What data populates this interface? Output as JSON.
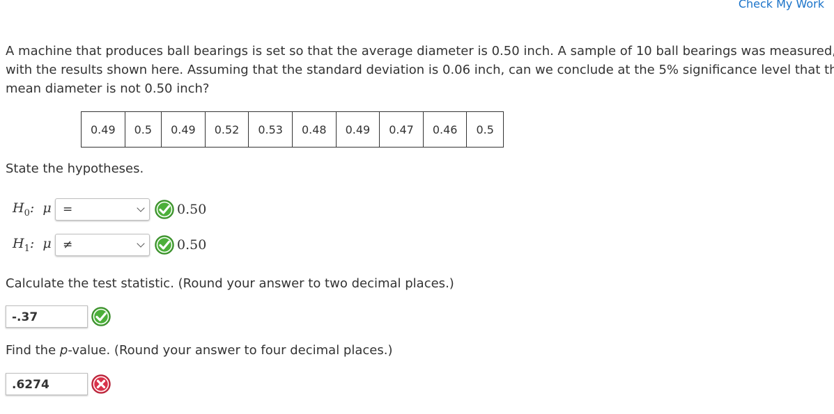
{
  "header": {
    "check_label": "Check My Work"
  },
  "question": {
    "line1": "A machine that produces ball bearings is set so that the average diameter is 0.50 inch. A sample of 10 ball bearings was measured,",
    "line2": "with the results shown here. Assuming that the standard deviation is 0.06 inch, can we conclude at the 5% significance level that the",
    "line3": "mean diameter is not 0.50 inch?"
  },
  "data_table": [
    "0.49",
    "0.5",
    "0.49",
    "0.52",
    "0.53",
    "0.48",
    "0.49",
    "0.47",
    "0.46",
    "0.5"
  ],
  "hypotheses": {
    "prompt": "State the hypotheses.",
    "h0": {
      "label_letter": "H",
      "label_sub": "0",
      "label_colon": ":",
      "mu": "μ",
      "operator": "=",
      "value": "0.50",
      "status": "correct"
    },
    "h1": {
      "label_letter": "H",
      "label_sub": "1",
      "label_colon": ":",
      "mu": "μ",
      "operator": "≠",
      "value": "0.50",
      "status": "correct"
    }
  },
  "test_statistic": {
    "prompt": "Calculate the test statistic. (Round your answer to two decimal places.)",
    "value": "-.37",
    "status": "correct"
  },
  "p_value": {
    "prompt_before": "Find the ",
    "prompt_italic": "p",
    "prompt_after": "-value. (Round your answer to four decimal places.)",
    "value": ".6274",
    "status": "incorrect"
  },
  "colors": {
    "link": "#1a73c9",
    "correct": "#4caf3a",
    "incorrect": "#d9324a",
    "text": "#333333"
  },
  "icons": {
    "correct": "check-circle-icon",
    "incorrect": "x-circle-icon",
    "dropdown": "chevron-down-icon"
  }
}
